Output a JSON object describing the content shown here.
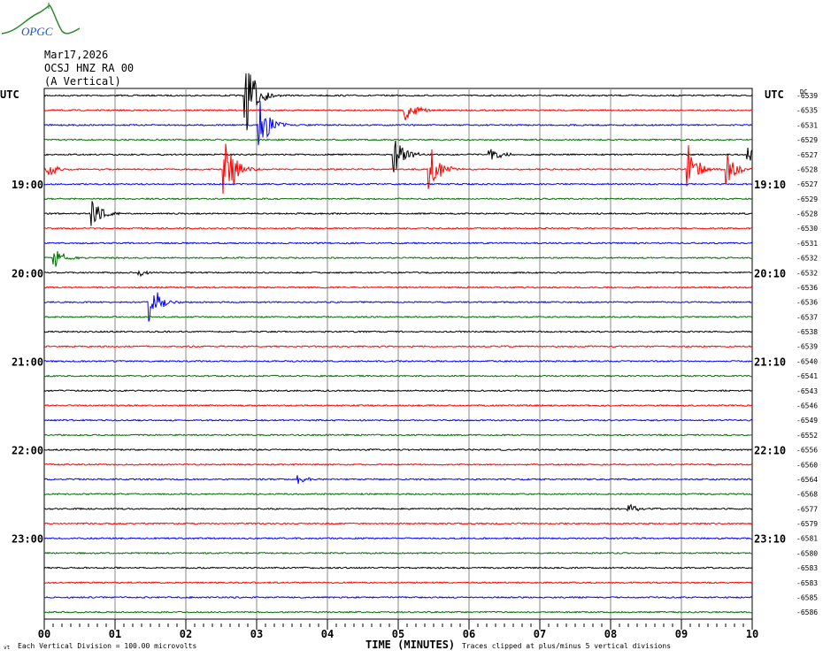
{
  "logo": {
    "text": "OPGC"
  },
  "header": {
    "date": "Mar17,2026",
    "station": "OCSJ HNZ RA 00",
    "component": "(A Vertical)"
  },
  "left_tz": "UTC",
  "right_tz": "UTC",
  "dc_label": "DC",
  "footer": {
    "scale": "Each Vertical Division =  100.00 microvolts",
    "xlabel": "TIME (MINUTES)",
    "clip_note": "Traces clipped at plus/minus 5 vertical divisions",
    "corner": "vt"
  },
  "chart_data": {
    "type": "line",
    "title": "OCSJ HNZ RA 00 helicorder",
    "xlabel": "TIME (MINUTES)",
    "xlim": [
      0,
      10
    ],
    "x_ticks": [
      "00",
      "01",
      "02",
      "03",
      "04",
      "05",
      "06",
      "07",
      "08",
      "09",
      "10"
    ],
    "trace_colors": [
      "#000000",
      "#ff0000",
      "#0000ff",
      "#007000"
    ],
    "left_time_labels": [
      {
        "row": 6,
        "label": "19:00"
      },
      {
        "row": 12,
        "label": "20:00"
      },
      {
        "row": 18,
        "label": "21:00"
      },
      {
        "row": 24,
        "label": "22:00"
      },
      {
        "row": 30,
        "label": "23:00"
      }
    ],
    "right_time_labels": [
      {
        "row": 6,
        "label": "19:10"
      },
      {
        "row": 12,
        "label": "20:10"
      },
      {
        "row": 18,
        "label": "21:10"
      },
      {
        "row": 24,
        "label": "22:10"
      },
      {
        "row": 30,
        "label": "23:10"
      }
    ],
    "dc_offsets": [
      -6539,
      -6535,
      -6531,
      -6529,
      -6527,
      -6528,
      -6527,
      -6529,
      -6528,
      -6530,
      -6531,
      -6532,
      -6532,
      -6536,
      -6536,
      -6537,
      -6538,
      -6539,
      -6540,
      -6541,
      -6543,
      -6546,
      -6549,
      -6552,
      -6556,
      -6560,
      -6564,
      -6568,
      -6577,
      -6579,
      -6581,
      -6580,
      -6583,
      -6583,
      -6585,
      -6586
    ],
    "events": [
      {
        "row": 0,
        "minute": 2.85,
        "amp": 3
      },
      {
        "row": 1,
        "minute": 5.1,
        "amp": 1
      },
      {
        "row": 2,
        "minute": 3.05,
        "amp": 2
      },
      {
        "row": 4,
        "minute": 4.95,
        "amp": 1.5
      },
      {
        "row": 4,
        "minute": 6.3,
        "amp": 0.7
      },
      {
        "row": 4,
        "minute": 9.95,
        "amp": 0.7
      },
      {
        "row": 5,
        "minute": 2.55,
        "amp": 3
      },
      {
        "row": 5,
        "minute": 5.45,
        "amp": 2
      },
      {
        "row": 5,
        "minute": 9.1,
        "amp": 2
      },
      {
        "row": 5,
        "minute": 9.65,
        "amp": 1.2
      },
      {
        "row": 5,
        "minute": 0.05,
        "amp": 0.6
      },
      {
        "row": 8,
        "minute": 0.68,
        "amp": 1
      },
      {
        "row": 11,
        "minute": 0.15,
        "amp": 0.8
      },
      {
        "row": 12,
        "minute": 1.35,
        "amp": 0.3
      },
      {
        "row": 14,
        "minute": 1.5,
        "amp": 1.6
      },
      {
        "row": 26,
        "minute": 3.6,
        "amp": 0.4
      },
      {
        "row": 28,
        "minute": 8.25,
        "amp": 0.4
      }
    ]
  }
}
